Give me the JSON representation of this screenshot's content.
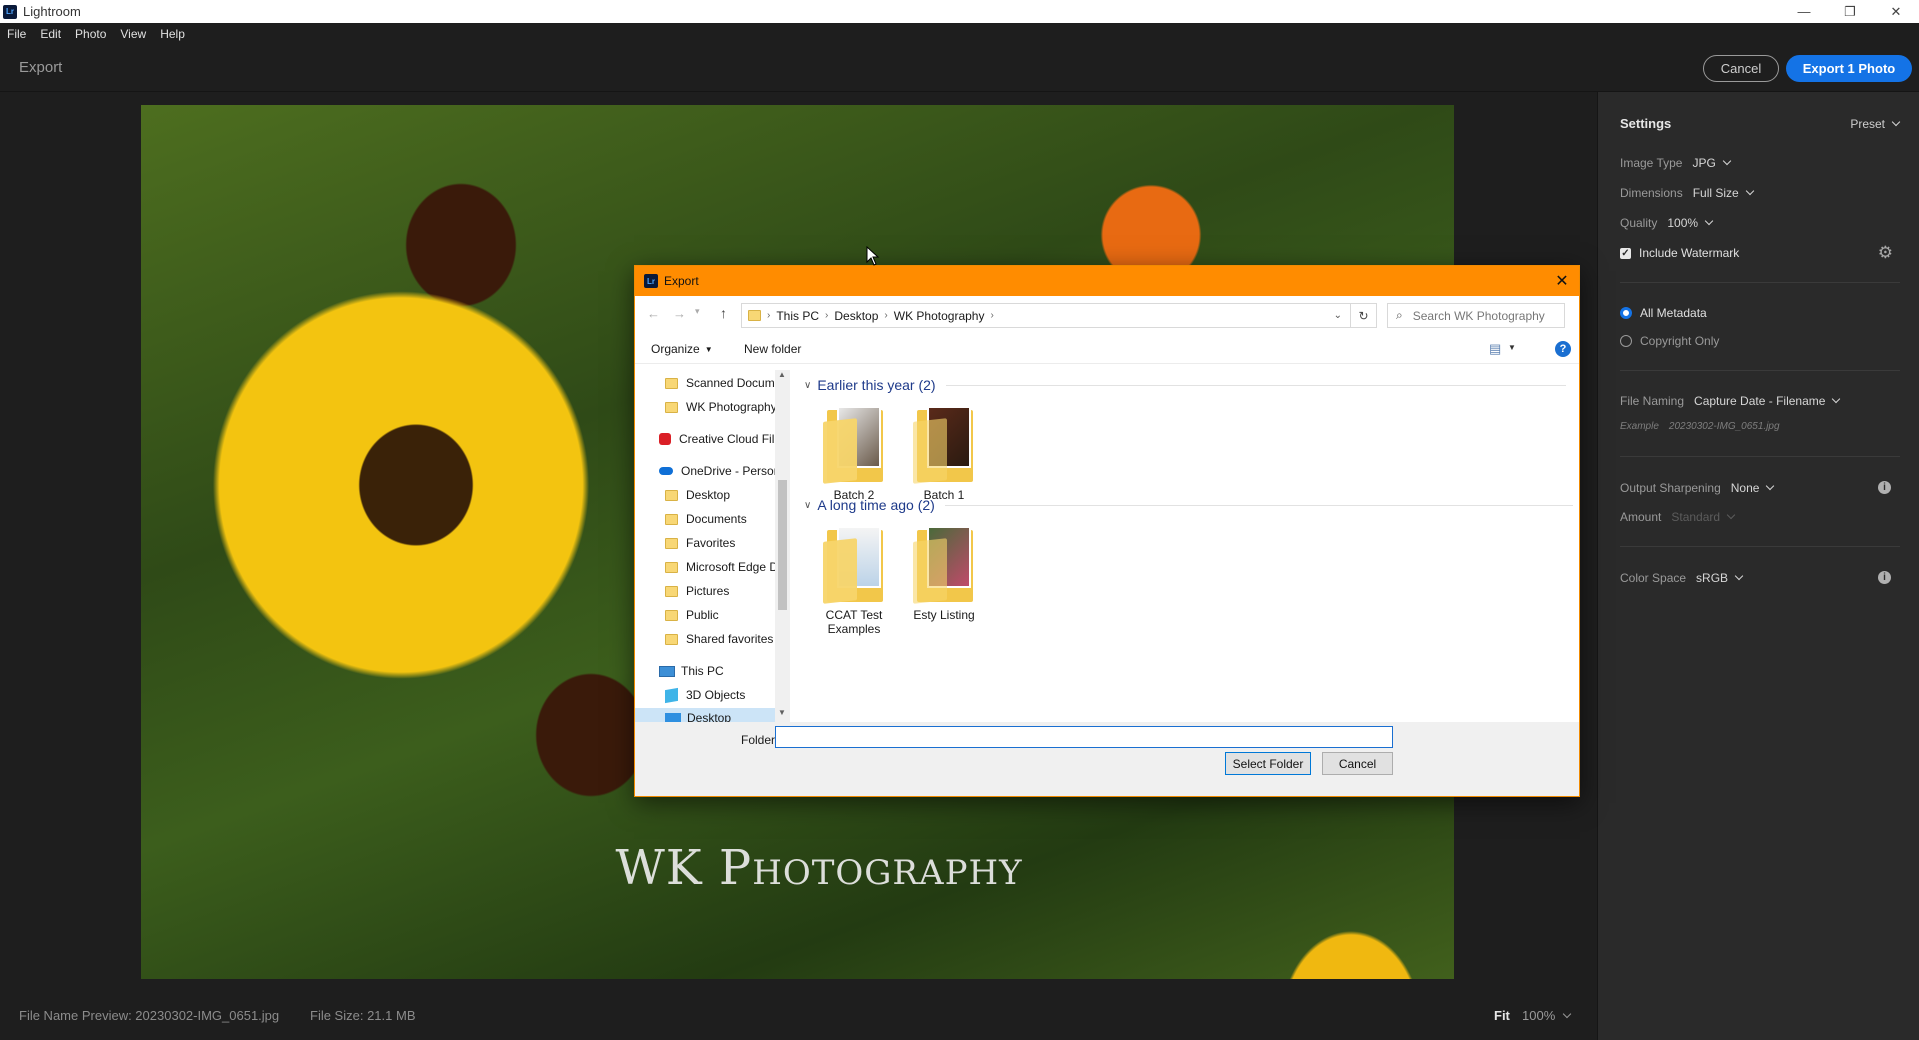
{
  "app": {
    "title": "Lightroom",
    "logo": "Lr"
  },
  "window_controls": {
    "minimize": "—",
    "restore": "❐",
    "close": "✕"
  },
  "menu": [
    "File",
    "Edit",
    "Photo",
    "View",
    "Help"
  ],
  "header": {
    "title": "Export",
    "cancel_label": "Cancel",
    "export_label": "Export 1 Photo"
  },
  "photo": {
    "watermark": "WK Photography"
  },
  "panel": {
    "settings_label": "Settings",
    "preset_label": "Preset",
    "image_type_label": "Image Type",
    "image_type_value": "JPG",
    "dimensions_label": "Dimensions",
    "dimensions_value": "Full Size",
    "quality_label": "Quality",
    "quality_value": "100%",
    "watermark_label": "Include Watermark",
    "watermark_checked": true,
    "metadata_all_label": "All Metadata",
    "metadata_copyright_label": "Copyright Only",
    "file_naming_label": "File Naming",
    "file_naming_value": "Capture Date - Filename",
    "example_label": "Example",
    "example_value": "20230302-IMG_0651.jpg",
    "sharpening_label": "Output Sharpening",
    "sharpening_value": "None",
    "amount_label": "Amount",
    "amount_value": "Standard",
    "color_space_label": "Color Space",
    "color_space_value": "sRGB",
    "accent": "#1473e6"
  },
  "bottombar": {
    "file_name_preview": "File Name Preview: 20230302-IMG_0651.jpg",
    "file_size": "File Size: 21.1 MB",
    "fit_label": "Fit",
    "zoom_value": "100%"
  },
  "dialog": {
    "title": "Export",
    "logo": "Lr",
    "close": "✕",
    "breadcrumb": [
      "This PC",
      "Desktop",
      "WK Photography"
    ],
    "search_placeholder": "Search WK Photography",
    "organize_label": "Organize",
    "new_folder_label": "New folder",
    "help_icon": "?",
    "nav_items": [
      {
        "label": "Scanned Docum",
        "kind": "folder"
      },
      {
        "label": "WK Photography",
        "kind": "folder"
      },
      {
        "label": "Creative Cloud Fil",
        "kind": "cc"
      },
      {
        "label": "OneDrive - Persor",
        "kind": "onedrive"
      },
      {
        "label": "Desktop",
        "kind": "folder"
      },
      {
        "label": "Documents",
        "kind": "folder"
      },
      {
        "label": "Favorites",
        "kind": "folder"
      },
      {
        "label": "Microsoft Edge D",
        "kind": "folder"
      },
      {
        "label": "Pictures",
        "kind": "folder"
      },
      {
        "label": "Public",
        "kind": "folder"
      },
      {
        "label": "Shared favorites",
        "kind": "folder"
      },
      {
        "label": "This PC",
        "kind": "pc"
      },
      {
        "label": "3D Objects",
        "kind": "3d"
      },
      {
        "label": "Desktop",
        "kind": "desktop"
      }
    ],
    "groups": [
      {
        "label": "Earlier this year (2)",
        "items": [
          "Batch 2",
          "Batch 1"
        ]
      },
      {
        "label": "A long time ago (2)",
        "items": [
          "CCAT Test Examples",
          "Esty Listing"
        ]
      }
    ],
    "folder_label": "Folder:",
    "folder_value": "",
    "select_label": "Select Folder",
    "cancel_label": "Cancel"
  }
}
